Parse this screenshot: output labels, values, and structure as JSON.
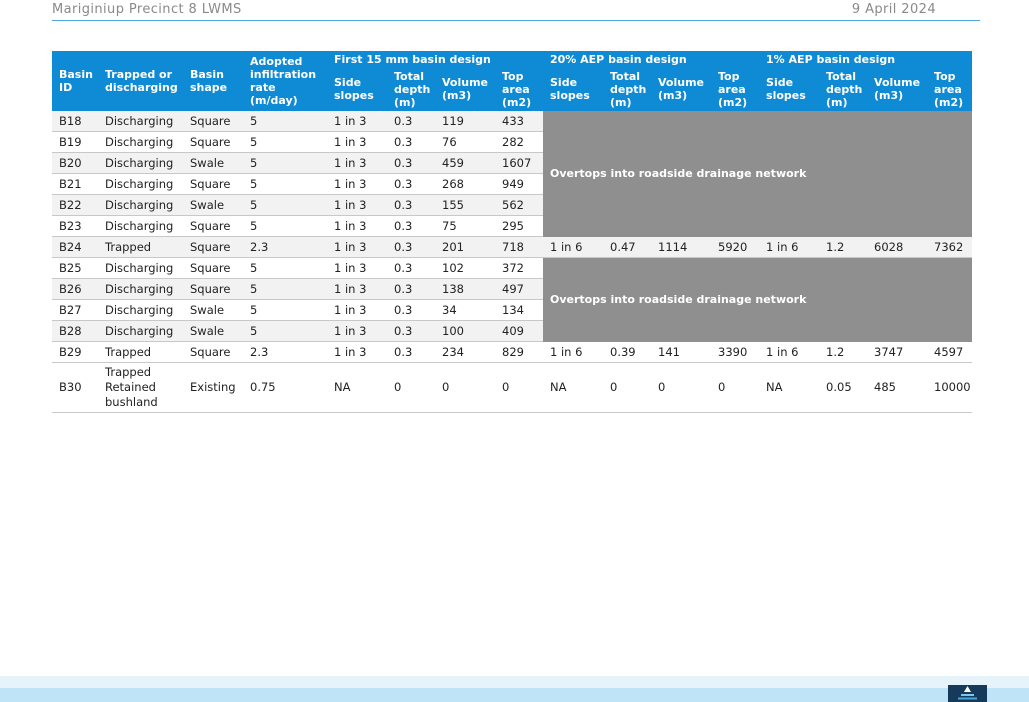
{
  "header": {
    "doc_title": "Mariginiup Precinct 8 LWMS",
    "date": "9 April 2024"
  },
  "table": {
    "group_headers": [
      "First 15 mm basin design",
      "20% AEP basin design",
      "1% AEP basin design"
    ],
    "base_headers": [
      "Basin ID",
      "Trapped or discharging",
      "Basin shape",
      "Adopted infiltration rate (m/day)"
    ],
    "design_headers": [
      "Side slopes",
      "Total depth (m)",
      "Volume (m3)",
      "Top area (m2)"
    ],
    "overtop_text": "Overtops into roadside drainage network",
    "rows": [
      {
        "cells": [
          "B18",
          "Discharging",
          "Square",
          "5",
          "1 in 3",
          "0.3",
          "119",
          "433"
        ]
      },
      {
        "cells": [
          "B19",
          "Discharging",
          "Square",
          "5",
          "1 in 3",
          "0.3",
          "76",
          "282"
        ]
      },
      {
        "cells": [
          "B20",
          "Discharging",
          "Swale",
          "5",
          "1 in 3",
          "0.3",
          "459",
          "1607"
        ]
      },
      {
        "cells": [
          "B21",
          "Discharging",
          "Square",
          "5",
          "1 in 3",
          "0.3",
          "268",
          "949"
        ]
      },
      {
        "cells": [
          "B22",
          "Discharging",
          "Swale",
          "5",
          "1 in 3",
          "0.3",
          "155",
          "562"
        ]
      },
      {
        "cells": [
          "B23",
          "Discharging",
          "Square",
          "5",
          "1 in 3",
          "0.3",
          "75",
          "295"
        ]
      },
      {
        "cells": [
          "B24",
          "Trapped",
          "Square",
          "2.3",
          "1 in 3",
          "0.3",
          "201",
          "718",
          "1 in 6",
          "0.47",
          "1114",
          "5920",
          "1 in 6",
          "1.2",
          "6028",
          "7362"
        ]
      },
      {
        "cells": [
          "B25",
          "Discharging",
          "Square",
          "5",
          "1 in 3",
          "0.3",
          "102",
          "372"
        ]
      },
      {
        "cells": [
          "B26",
          "Discharging",
          "Square",
          "5",
          "1 in 3",
          "0.3",
          "138",
          "497"
        ]
      },
      {
        "cells": [
          "B27",
          "Discharging",
          "Swale",
          "5",
          "1 in 3",
          "0.3",
          "34",
          "134"
        ]
      },
      {
        "cells": [
          "B28",
          "Discharging",
          "Swale",
          "5",
          "1 in 3",
          "0.3",
          "100",
          "409"
        ]
      },
      {
        "cells": [
          "B29",
          "Trapped",
          "Square",
          "2.3",
          "1 in 3",
          "0.3",
          "234",
          "829",
          "1 in 6",
          "0.39",
          "141",
          "3390",
          "1 in 6",
          "1.2",
          "3747",
          "4597"
        ]
      },
      {
        "cells": [
          "B30",
          "Trapped Retained bushland",
          "Existing",
          "0.75",
          "NA",
          "0",
          "0",
          "0",
          "NA",
          "0",
          "0",
          "0",
          "NA",
          "0.05",
          "485",
          "10000"
        ]
      }
    ]
  },
  "footer": {
    "logo_icon": "water-drop-logo-icon",
    "colors": {
      "band_light": "#e6f3fb",
      "band": "#bfe3f7",
      "logo_bg": "#163a5a",
      "accent": "#0f8ad4"
    }
  }
}
